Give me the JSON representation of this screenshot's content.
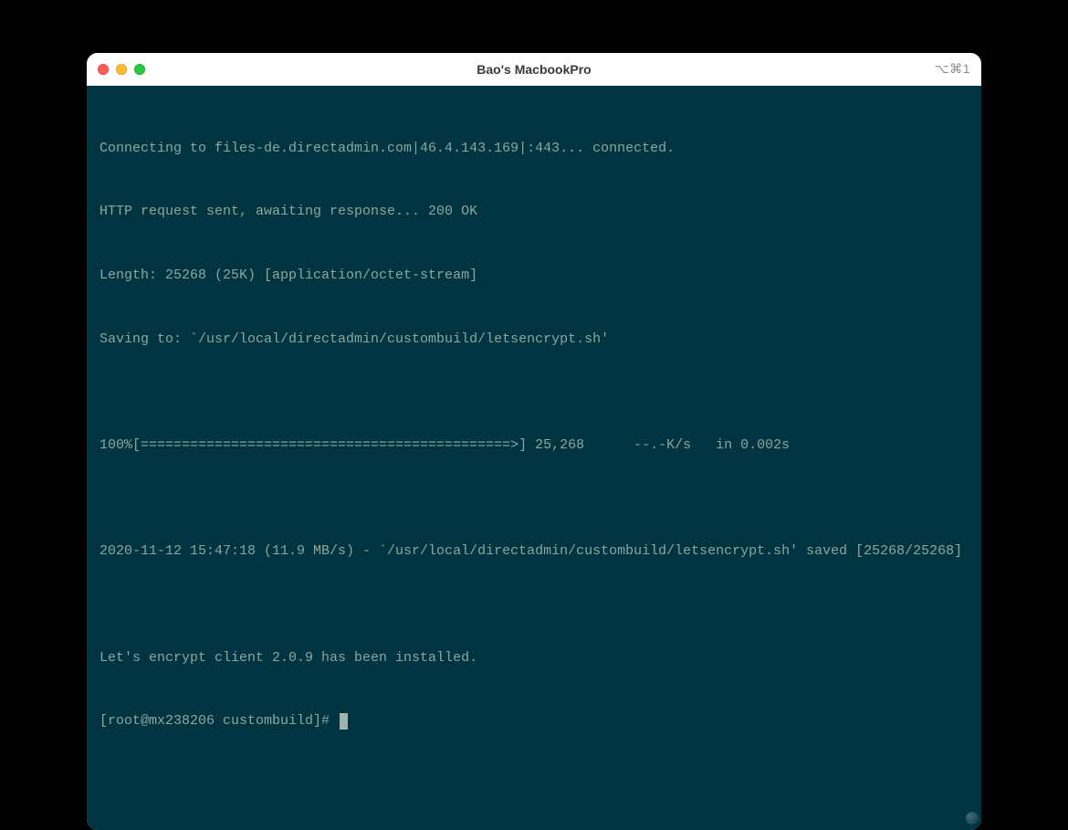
{
  "window": {
    "title": "Bao's MacbookPro",
    "shortcut_indicator": "⌥⌘1"
  },
  "traffic_lights": {
    "close": "close",
    "minimize": "minimize",
    "zoom": "zoom"
  },
  "terminal": {
    "lines": [
      "Connecting to files-de.directadmin.com|46.4.143.169|:443... connected.",
      "HTTP request sent, awaiting response... 200 OK",
      "Length: 25268 (25K) [application/octet-stream]",
      "Saving to: `/usr/local/directadmin/custombuild/letsencrypt.sh'",
      "",
      "100%[=============================================>] 25,268      --.-K/s   in 0.002s",
      "",
      "2020-11-12 15:47:18 (11.9 MB/s) - `/usr/local/directadmin/custombuild/letsencrypt.sh' saved [25268/25268]",
      "",
      "Let's encrypt client 2.0.9 has been installed."
    ],
    "prompt": "[root@mx238206 custombuild]# "
  },
  "colors": {
    "terminal_bg": "#003440",
    "terminal_fg": "#8aa8a1"
  }
}
